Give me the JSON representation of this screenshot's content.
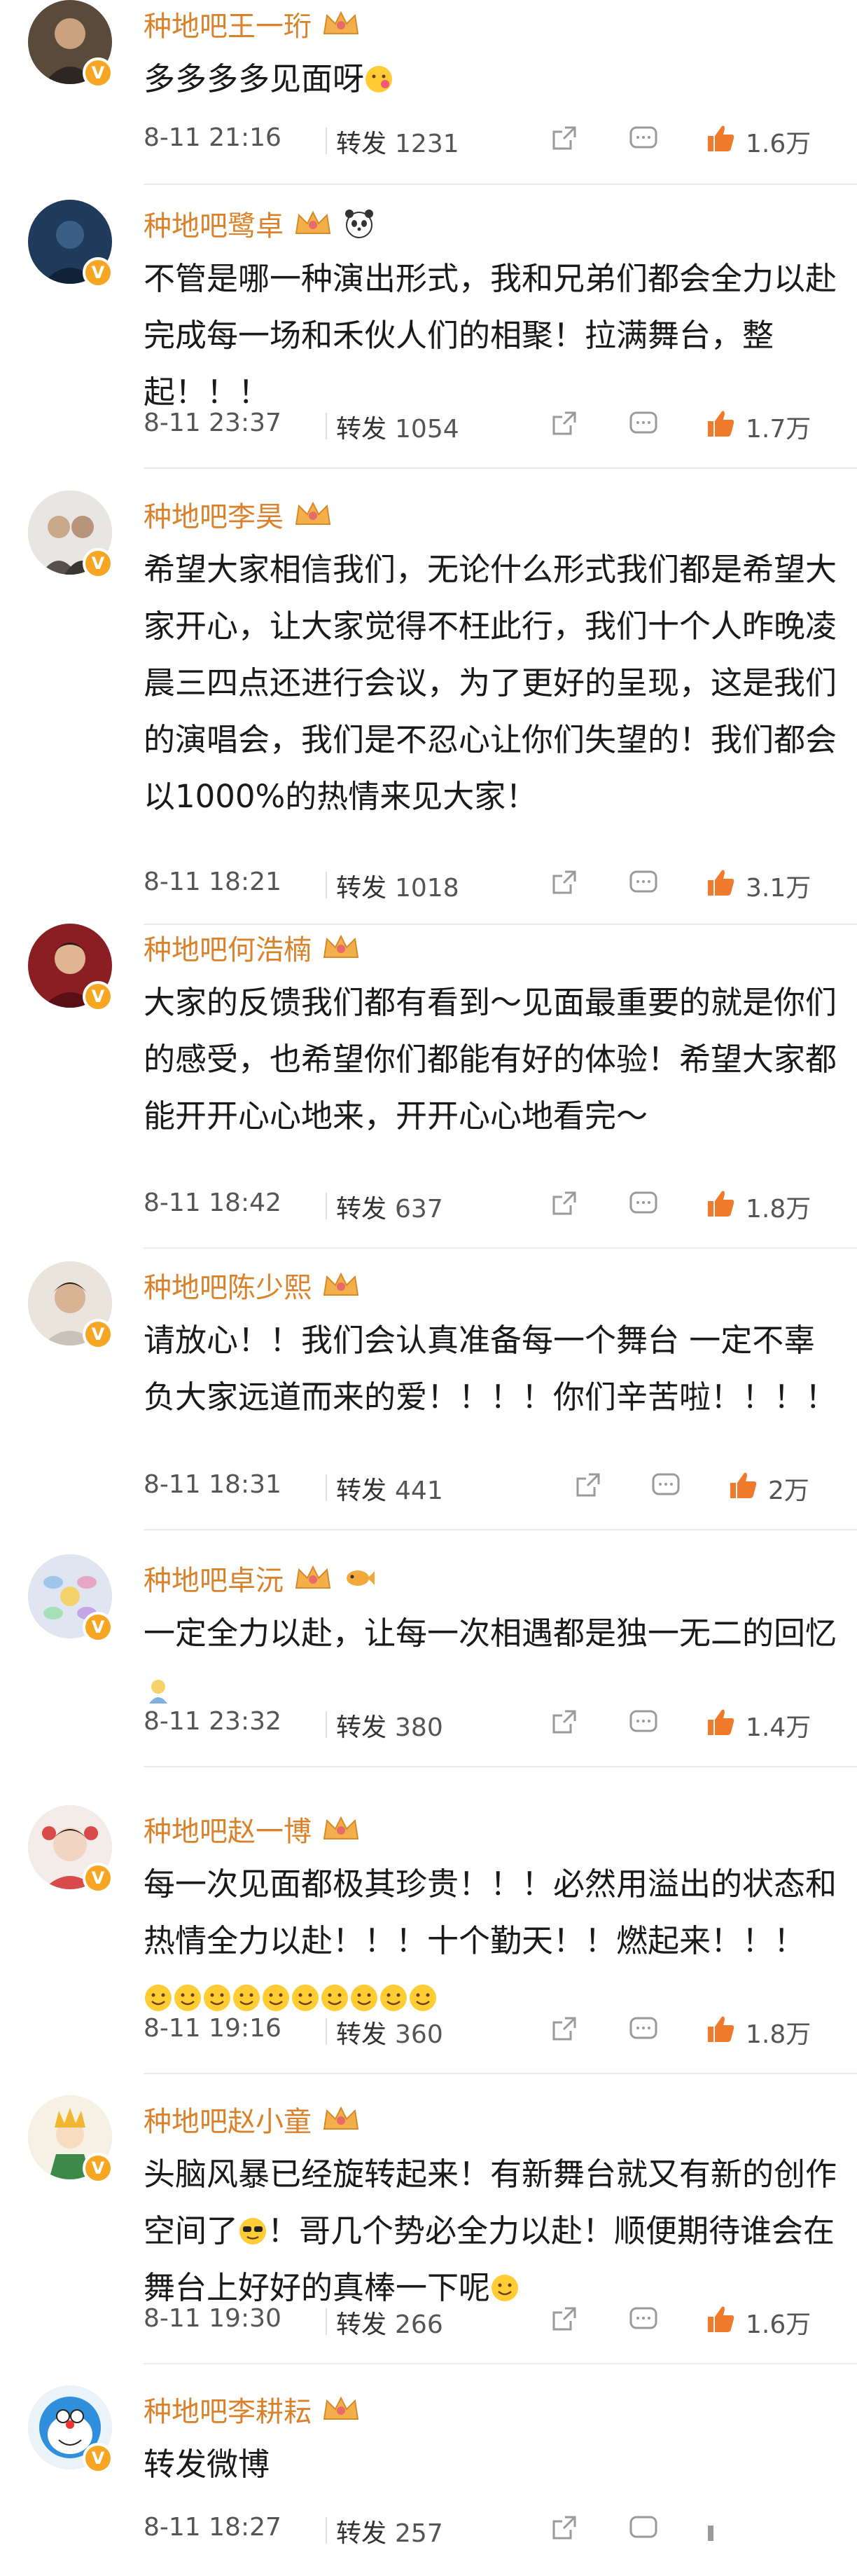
{
  "colors": {
    "name": "#d9822b",
    "badge": "#f6a623",
    "like": "#f07a2c",
    "icon": "#9a9a9a"
  },
  "posts": [
    {
      "name": "种地吧王一珩",
      "text": "多多多多见面呀",
      "time": "8-11 21:16",
      "forward_label": "转发",
      "forward_count": "1231",
      "likes": "1.6万",
      "icons": [
        "share-icon",
        "comment-icon",
        "thumbs-up-icon"
      ]
    },
    {
      "name": "种地吧鹭卓",
      "text": "不管是哪一种演出形式，我和兄弟们都会全力以赴完成每一场和禾伙人们的相聚！拉满舞台，整起！！！",
      "time": "8-11 23:37",
      "forward_label": "转发",
      "forward_count": "1054",
      "likes": "1.7万"
    },
    {
      "name": "种地吧李昊",
      "text": "希望大家相信我们，无论什么形式我们都是希望大家开心，让大家觉得不枉此行，我们十个人昨晚凌晨三四点还进行会议，为了更好的呈现，这是我们的演唱会，我们是不忍心让你们失望的！我们都会以1000%的热情来见大家！",
      "time": "8-11 18:21",
      "forward_label": "转发",
      "forward_count": "1018",
      "likes": "3.1万"
    },
    {
      "name": "种地吧何浩楠",
      "text": "大家的反馈我们都有看到～见面最重要的就是你们的感受，也希望你们都能有好的体验！希望大家都能开开心心地来，开开心心地看完～",
      "time": "8-11 18:42",
      "forward_label": "转发",
      "forward_count": "637",
      "likes": "1.8万"
    },
    {
      "name": "种地吧陈少熙",
      "text": "请放心！！我们会认真准备每一个舞台 一定不辜负大家远道而来的爱！！！！你们辛苦啦！！！！",
      "time": "8-11 18:31",
      "forward_label": "转发",
      "forward_count": "441",
      "likes": "2万"
    },
    {
      "name": "种地吧卓沅",
      "text": "一定全力以赴，让每一次相遇都是独一无二的回忆",
      "time": "8-11 23:32",
      "forward_label": "转发",
      "forward_count": "380",
      "likes": "1.4万"
    },
    {
      "name": "种地吧赵一博",
      "text": "每一次见面都极其珍贵！！！必然用溢出的状态和热情全力以赴！！！十个勤天！！燃起来！！！",
      "time": "8-11 19:16",
      "forward_label": "转发",
      "forward_count": "360",
      "likes": "1.8万"
    },
    {
      "name": "种地吧赵小童",
      "text_a": "头脑风暴已经旋转起来！有新舞台就又有新的创作空间了",
      "text_b": "！哥几个势必全力以赴！顺便期待谁会在舞台上好好的真棒一下呢",
      "time": "8-11 19:30",
      "forward_label": "转发",
      "forward_count": "266",
      "likes": "1.6万"
    },
    {
      "name": "种地吧李耕耘",
      "text": "转发微博",
      "time": "8-11 18:27",
      "forward_label": "转发",
      "forward_count": "257"
    }
  ]
}
